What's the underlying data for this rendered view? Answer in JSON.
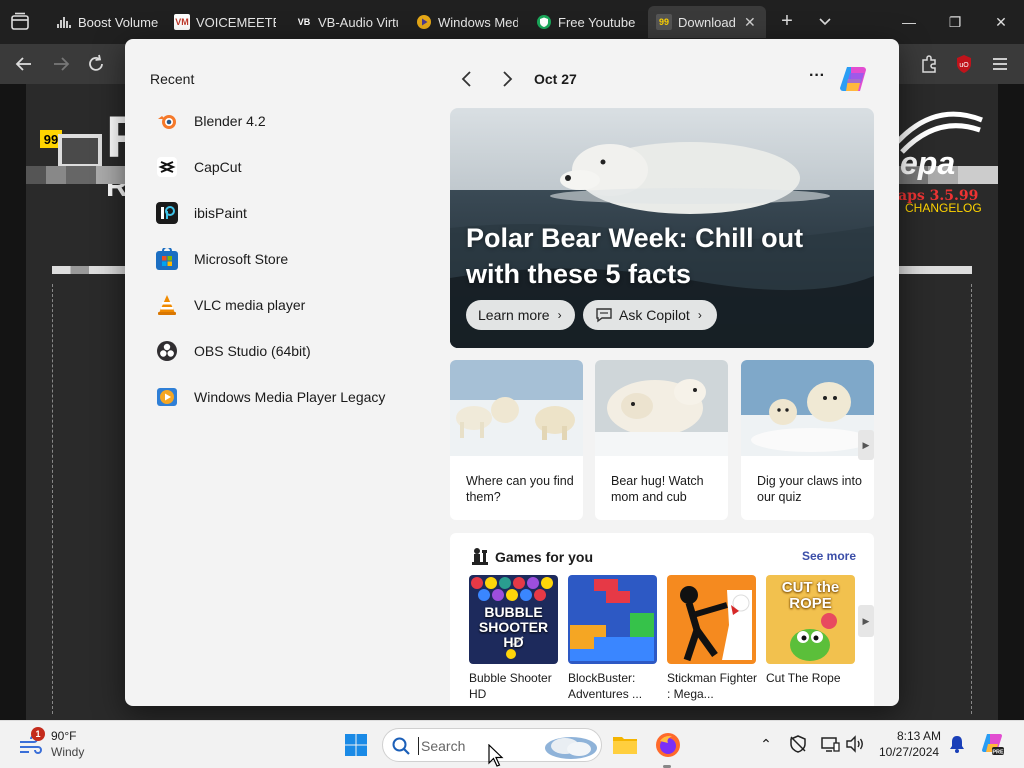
{
  "browser": {
    "tabs": [
      {
        "label": "Boost Volume",
        "favicon": "bars-icon",
        "color": "#333333"
      },
      {
        "label": "VOICEMEETER",
        "favicon": "VM",
        "color": "#c0392b"
      },
      {
        "label": "VB-Audio Virtu",
        "favicon": "VB",
        "color": "#222222"
      },
      {
        "label": "Windows Medi",
        "favicon": "wmp-icon",
        "color": "#e6a817"
      },
      {
        "label": "Free Youtube V",
        "favicon": "shield-icon",
        "color": "#1aa85a"
      },
      {
        "label": "Download F",
        "favicon": "99",
        "color": "#555555",
        "active": true
      }
    ],
    "close_glyph": "✕",
    "add_glyph": "+"
  },
  "page_bg": {
    "changelog": "CHANGELOG",
    "version_text": "aps 3.5.99"
  },
  "widgets": {
    "recent_title": "Recent",
    "recent_items": [
      {
        "label": "Blender 4.2",
        "icon": "blender-icon"
      },
      {
        "label": "CapCut",
        "icon": "capcut-icon"
      },
      {
        "label": "ibisPaint",
        "icon": "ibispaint-icon"
      },
      {
        "label": "Microsoft Store",
        "icon": "store-icon"
      },
      {
        "label": "VLC media player",
        "icon": "vlc-icon"
      },
      {
        "label": "OBS Studio (64bit)",
        "icon": "obs-icon"
      },
      {
        "label": "Windows Media Player Legacy",
        "icon": "wmp-icon"
      }
    ],
    "date": "Oct 27",
    "more_glyph": "···",
    "hero": {
      "title": "Polar Bear Week: Chill out with these 5 facts",
      "learn_more": "Learn more",
      "ask_copilot": "Ask Copilot"
    },
    "cards": [
      {
        "text": "Where can you find them?"
      },
      {
        "text": "Bear hug! Watch mom and cub"
      },
      {
        "text": "Dig your claws into our quiz"
      }
    ],
    "games": {
      "title": "Games for you",
      "see_more": "See more",
      "items": [
        {
          "name": "Bubble Shooter HD",
          "tile_text": "BUBBLE SHOOTER HD"
        },
        {
          "name": "BlockBuster: Adventures ..."
        },
        {
          "name": "Stickman Fighter : Mega..."
        },
        {
          "name": "Cut The Rope",
          "tile_text": "CUT the ROPE"
        }
      ]
    }
  },
  "taskbar": {
    "weather_temp": "90°F",
    "weather_cond": "Windy",
    "weather_badge": "1",
    "search_placeholder": "Search",
    "time": "8:13 AM",
    "date": "10/27/2024"
  }
}
